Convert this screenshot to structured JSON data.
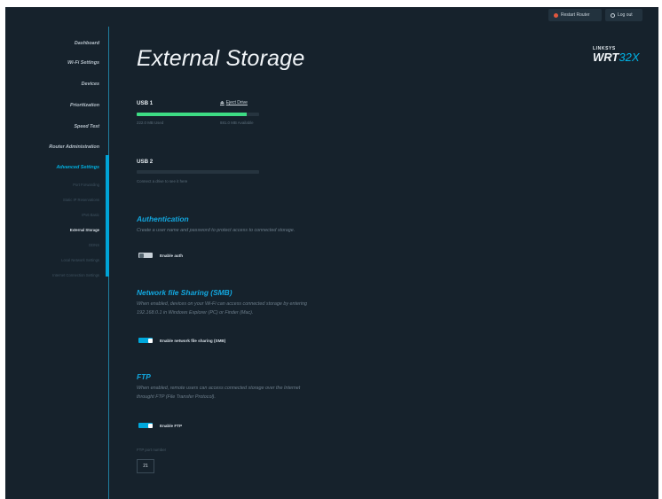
{
  "header": {
    "restart_label": "Restart Router",
    "logout_label": "Log out"
  },
  "sidebar": {
    "items": [
      {
        "label": "Dashboard"
      },
      {
        "label": "Wi-Fi Settings"
      },
      {
        "label": "Devices"
      },
      {
        "label": "Prioritization"
      },
      {
        "label": "Speed Test"
      },
      {
        "label": "Router Administration"
      },
      {
        "label": "Advanced Settings"
      }
    ],
    "sub_items": [
      {
        "label": "Port Forwarding"
      },
      {
        "label": "Static IP Reservations"
      },
      {
        "label": "IPv6 Basic"
      },
      {
        "label": "External Storage"
      },
      {
        "label": "DDNS"
      },
      {
        "label": "Local Network Settings"
      },
      {
        "label": "Internet Connection Settings"
      }
    ]
  },
  "main": {
    "title": "External Storage",
    "usb1": {
      "label": "USB 1",
      "eject_label": "Eject Drive",
      "used": "222.0 MB Used",
      "available": "881.0 MB Available",
      "used_fraction": 0.9
    },
    "usb2": {
      "label": "USB 2",
      "note": "Connect a drive to see it here",
      "used_fraction": 0
    },
    "auth": {
      "title": "Authentication",
      "description": "Create a user name and password to protect access to connected storage.",
      "toggle_label": "Enable auth",
      "enabled": false
    },
    "smb": {
      "title": "Network file Sharing (SMB)",
      "description_line1": "When enabled, devices on your Wi-Fi can access connected storage by entering",
      "description_line2": "192.168.0.1 in Windows Explorer (PC) or Finder (Mac).",
      "toggle_label": "Enable network file sharing (SMB)",
      "enabled": true
    },
    "ftp": {
      "title": "FTP",
      "description_line1": "When enabled, remote users can access connected storage over the Internet",
      "description_line2": "throught FTP (File Transfer Protocol).",
      "toggle_label": "Enable FTP",
      "enabled": true,
      "port_label": "FTP port number",
      "port_value": "21"
    }
  },
  "brand": {
    "top": "LINKSYS",
    "main": "WRT",
    "accent": "32X"
  },
  "colors": {
    "background": "#16222c",
    "accent": "#00a8dc",
    "usage_bar": "#3ddc84",
    "restart_icon": "#e0573e"
  }
}
